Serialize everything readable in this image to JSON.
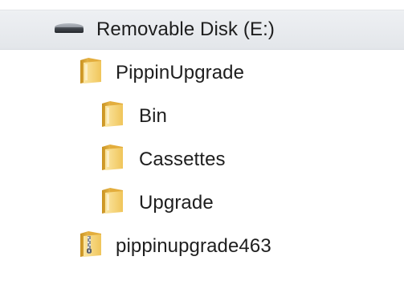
{
  "tree": {
    "drive": {
      "label": "Removable Disk (E:)",
      "icon": "removable-drive-icon"
    },
    "items": [
      {
        "label": "PippinUpgrade",
        "icon": "folder-icon",
        "level": 1
      },
      {
        "label": "Bin",
        "icon": "folder-icon",
        "level": 2
      },
      {
        "label": "Cassettes",
        "icon": "folder-icon",
        "level": 2
      },
      {
        "label": "Upgrade",
        "icon": "folder-icon",
        "level": 2
      },
      {
        "label": "pippinupgrade463",
        "icon": "zipped-folder-icon",
        "level": 1
      }
    ]
  },
  "colors": {
    "folder_light": "#f8d97a",
    "folder_dark": "#d9a93a",
    "drive_bar": "#e6e8ec"
  }
}
